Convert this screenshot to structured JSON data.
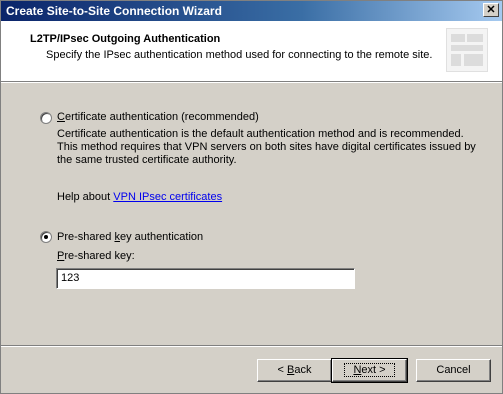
{
  "window": {
    "title": "Create Site-to-Site Connection Wizard",
    "close_glyph": "✕"
  },
  "header": {
    "title": "L2TP/IPsec Outgoing Authentication",
    "subtitle": "Specify the IPsec authentication method used for connecting to the remote site."
  },
  "options": {
    "certificate": {
      "label_prefix": "",
      "label_accel": "C",
      "label_rest": "ertificate authentication (recommended)",
      "selected": false,
      "description": "Certificate authentication is the default authentication method and is recommended. This method requires that VPN servers on both sites have digital certificates issued by the same trusted certificate authority."
    },
    "help": {
      "prefix": "Help about ",
      "link_text": "VPN IPsec certificates"
    },
    "preshared": {
      "label_prefix": "Pre-shared ",
      "label_accel": "k",
      "label_rest": "ey authentication",
      "selected": true
    }
  },
  "preshared_key": {
    "label_accel": "P",
    "label_rest": "re-shared key:",
    "value": "123"
  },
  "buttons": {
    "back": {
      "arrow": "< ",
      "accel": "B",
      "rest": "ack"
    },
    "next": {
      "accel": "N",
      "rest": "ext",
      "arrow": " >"
    },
    "cancel": {
      "label": "Cancel"
    }
  }
}
